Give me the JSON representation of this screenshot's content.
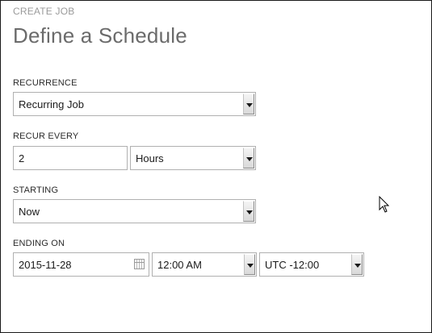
{
  "header": {
    "breadcrumb": "CREATE JOB",
    "title": "Define a Schedule"
  },
  "recurrence": {
    "label": "RECURRENCE",
    "value": "Recurring Job"
  },
  "recur_every": {
    "label": "RECUR EVERY",
    "amount": "2",
    "unit": "Hours"
  },
  "starting": {
    "label": "STARTING",
    "value": "Now"
  },
  "ending_on": {
    "label": "ENDING ON",
    "date": "2015-11-28",
    "time": "12:00 AM",
    "timezone": "UTC -12:00"
  },
  "icons": {
    "calendar": "calendar-icon",
    "dropdown": "chevron-down-icon",
    "cursor": "mouse-pointer-icon"
  }
}
